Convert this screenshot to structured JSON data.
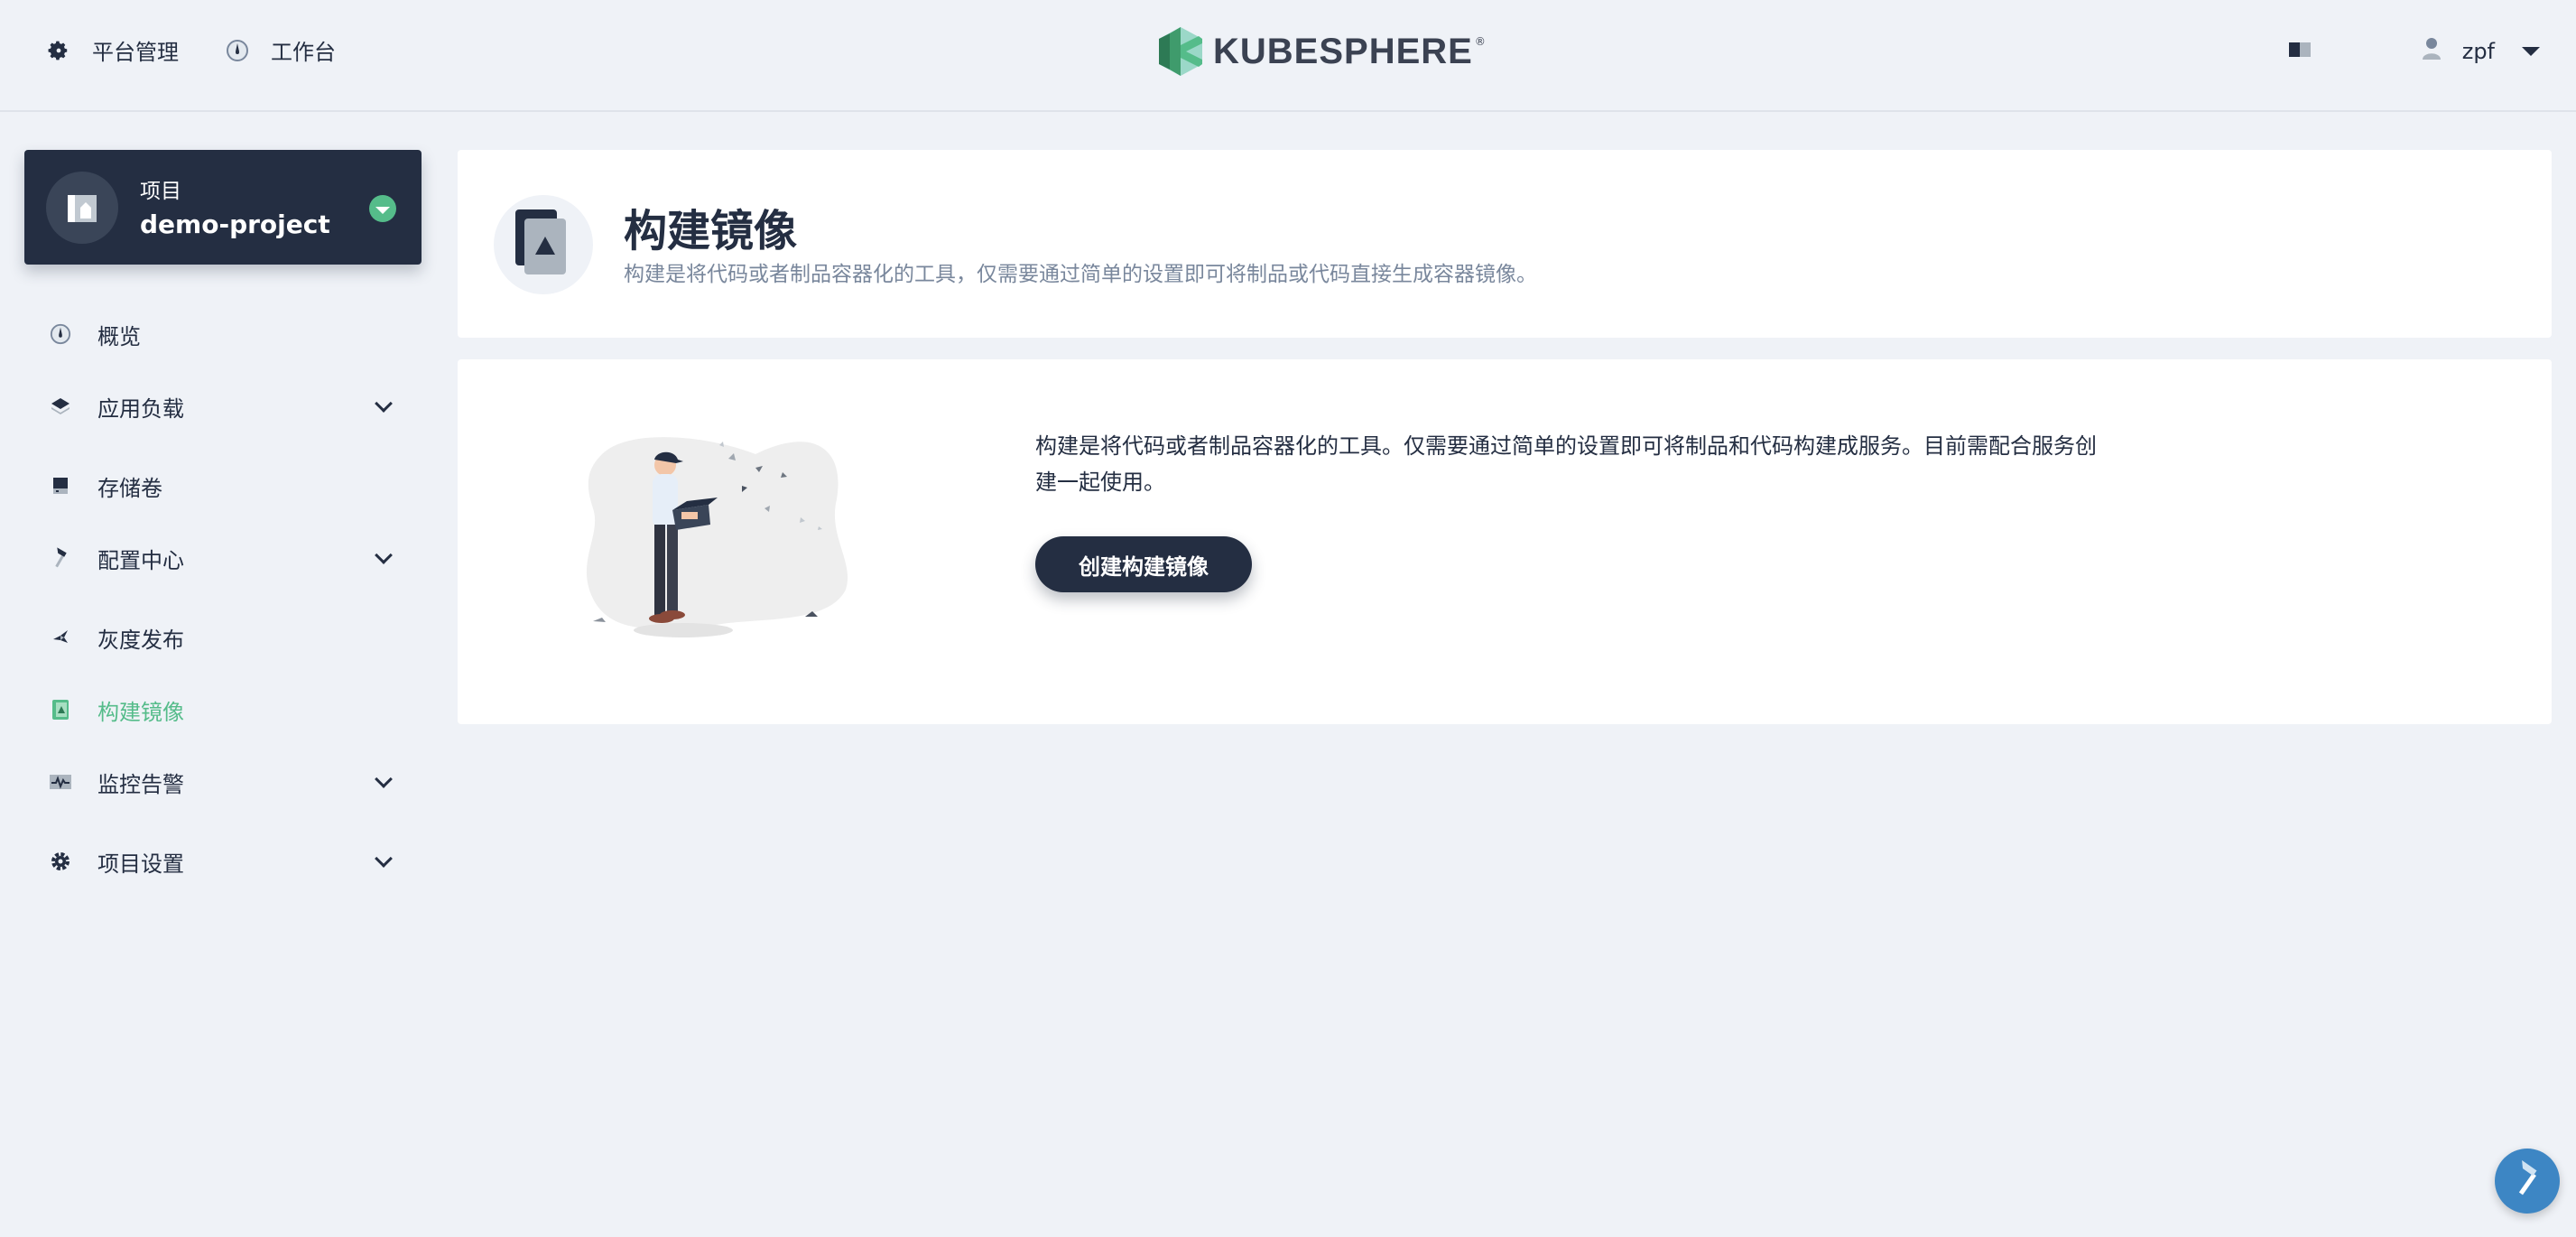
{
  "header": {
    "nav": [
      {
        "label": "平台管理",
        "icon": "gear-icon"
      },
      {
        "label": "工作台",
        "icon": "dashboard-icon"
      }
    ],
    "logo_text": "KUBESPHERE",
    "logo_reg": "®",
    "user": {
      "name": "zpf"
    }
  },
  "sidebar": {
    "project": {
      "label": "项目",
      "name": "demo-project"
    },
    "items": [
      {
        "label": "概览",
        "icon": "dashboard-icon",
        "expandable": false,
        "active": false
      },
      {
        "label": "应用负载",
        "icon": "layers-icon",
        "expandable": true,
        "active": false
      },
      {
        "label": "存储卷",
        "icon": "storage-icon",
        "expandable": false,
        "active": false
      },
      {
        "label": "配置中心",
        "icon": "hammer-icon",
        "expandable": true,
        "active": false
      },
      {
        "label": "灰度发布",
        "icon": "bird-icon",
        "expandable": false,
        "active": false
      },
      {
        "label": "构建镜像",
        "icon": "image-build-icon",
        "expandable": false,
        "active": true
      },
      {
        "label": "监控告警",
        "icon": "monitor-icon",
        "expandable": true,
        "active": false
      },
      {
        "label": "项目设置",
        "icon": "gear-icon",
        "expandable": true,
        "active": false
      }
    ]
  },
  "main": {
    "title": "构建镜像",
    "description": "构建是将代码或者制品容器化的工具，仅需要通过简单的设置即可将制品或代码直接生成容器镜像。",
    "empty": {
      "text": "构建是将代码或者制品容器化的工具。仅需要通过简单的设置即可将制品和代码构建成服务。目前需配合服务创建一起使用。",
      "button": "创建构建镜像"
    }
  },
  "colors": {
    "accent": "#55bc8a",
    "dark": "#242e42",
    "background": "#eff2f7",
    "tool": "#3d86c4"
  }
}
